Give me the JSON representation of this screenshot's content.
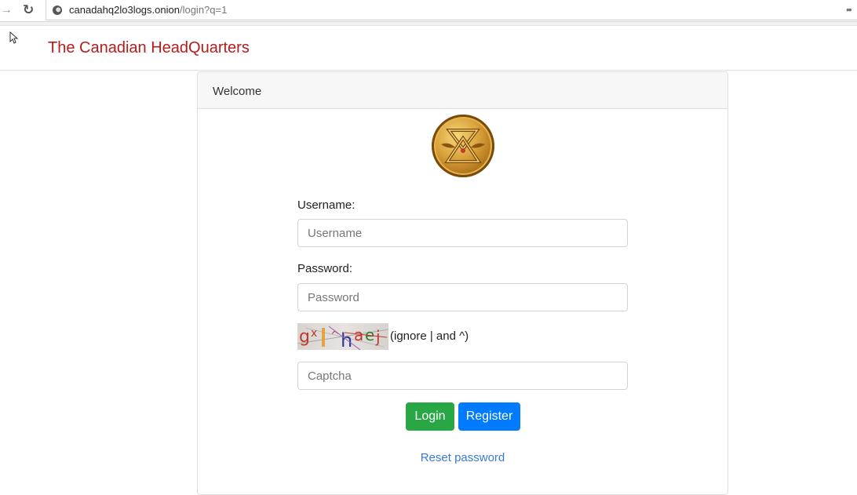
{
  "browser": {
    "forward_icon": "arrow-right-icon",
    "reload_icon": "reload-icon",
    "url_host": "canadahq2lo3logs.onion",
    "url_path": "/login?q=1",
    "menu_icon": "more-icon"
  },
  "navbar": {
    "brand": "The Canadian HeadQuarters"
  },
  "card": {
    "header": "Welcome",
    "logo_icon": "gold-emblem-logo"
  },
  "form": {
    "username_label": "Username:",
    "username_placeholder": "Username",
    "username_value": "",
    "password_label": "Password:",
    "password_placeholder": "Password",
    "password_value": "",
    "captcha_text": "gx|^haej",
    "captcha_hint": "(ignore | and ^)",
    "captcha_placeholder": "Captcha",
    "captcha_value": "",
    "login_label": "Login",
    "register_label": "Register",
    "reset_label": "Reset password"
  },
  "colors": {
    "brand": "#b71c1c",
    "login": "#28a745",
    "register": "#007bff",
    "link": "#3a7bd5"
  }
}
